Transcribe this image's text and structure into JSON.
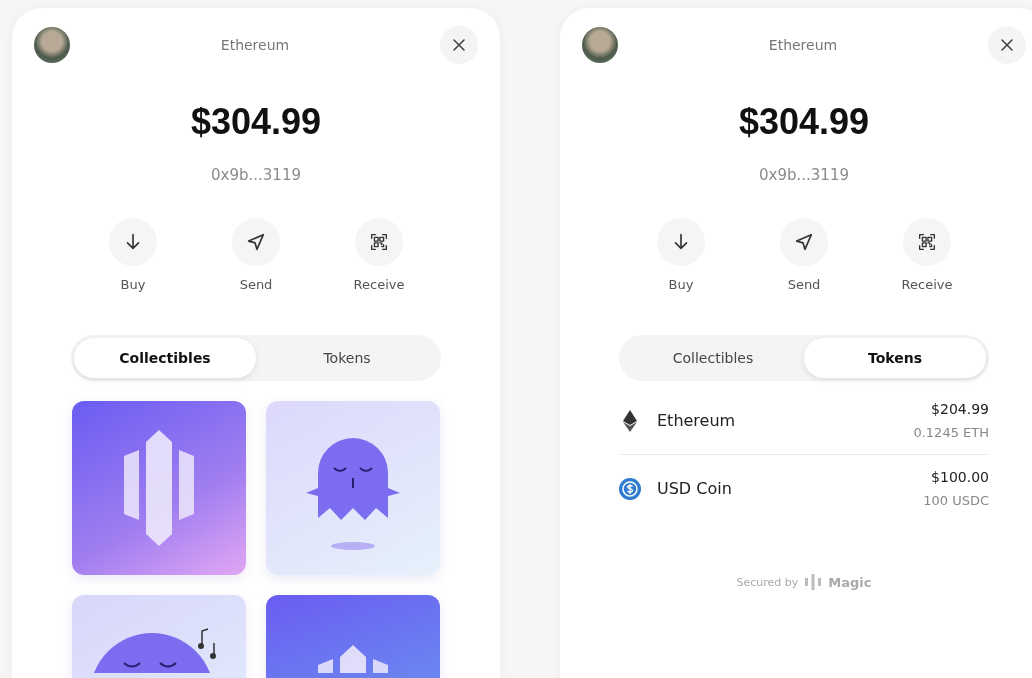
{
  "panels": [
    {
      "title": "Ethereum",
      "balance": "$304.99",
      "address": "0x9b...3119",
      "actions": [
        {
          "kind": "buy",
          "label": "Buy"
        },
        {
          "kind": "send",
          "label": "Send"
        },
        {
          "kind": "receive",
          "label": "Receive"
        }
      ],
      "tabs": [
        {
          "label": "Collectibles",
          "selected": true
        },
        {
          "label": "Tokens",
          "selected": false
        }
      ]
    },
    {
      "title": "Ethereum",
      "balance": "$304.99",
      "address": "0x9b...3119",
      "actions": [
        {
          "kind": "buy",
          "label": "Buy"
        },
        {
          "kind": "send",
          "label": "Send"
        },
        {
          "kind": "receive",
          "label": "Receive"
        }
      ],
      "tabs": [
        {
          "label": "Collectibles",
          "selected": false
        },
        {
          "label": "Tokens",
          "selected": true
        }
      ],
      "tokens": [
        {
          "kind": "eth",
          "name": "Ethereum",
          "value": "$204.99",
          "amount": "0.1245 ETH"
        },
        {
          "kind": "usdc",
          "name": "USD Coin",
          "value": "$100.00",
          "amount": "100 USDC"
        }
      ],
      "footer": {
        "prefix": "Secured by",
        "brand": "Magic"
      }
    }
  ]
}
